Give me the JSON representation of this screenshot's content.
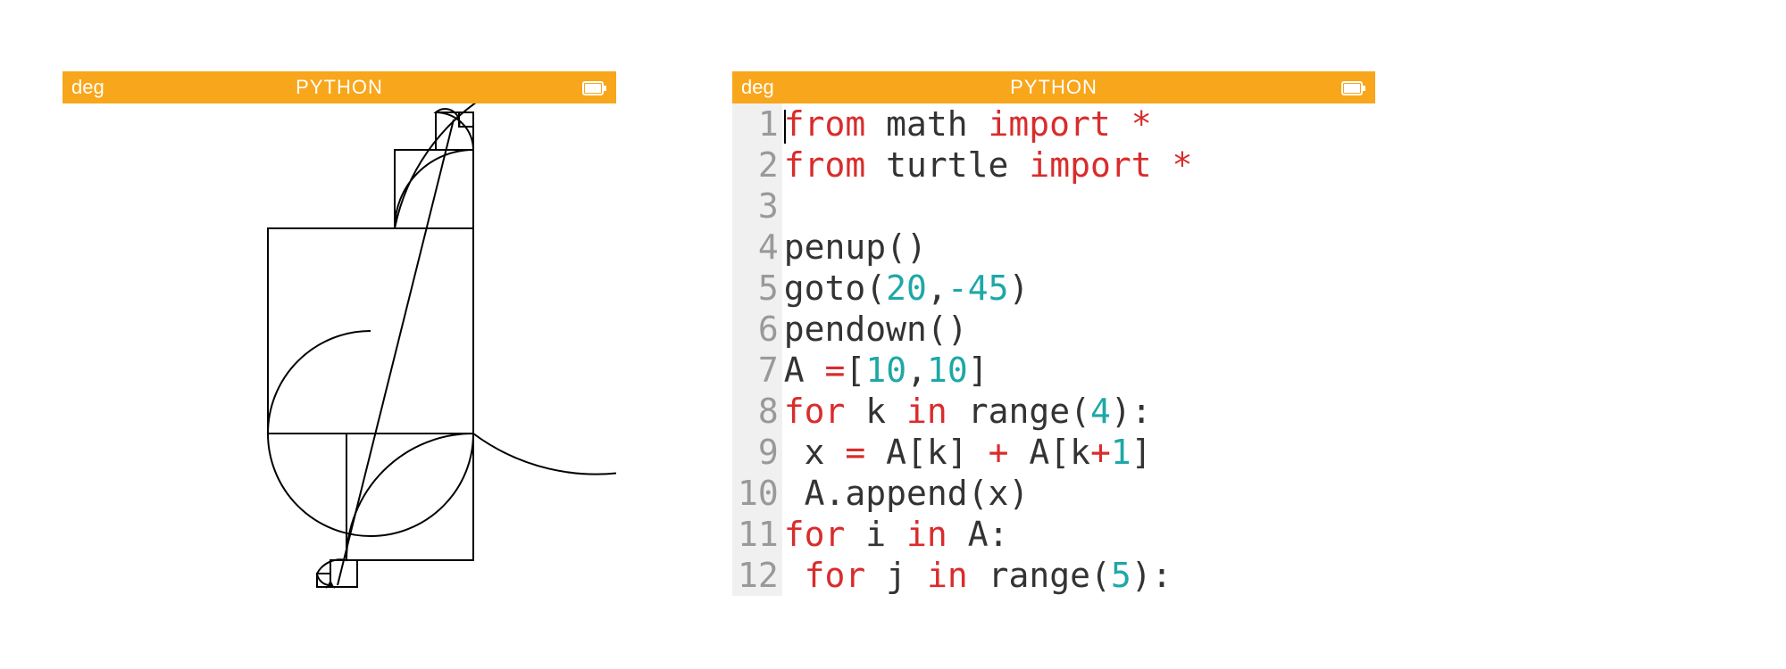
{
  "colors": {
    "titlebar_bg": "#f8a61b",
    "titlebar_fg": "#ffffff",
    "keyword": "#d92c2c",
    "number": "#1fa7a7",
    "text": "#333333",
    "gutter_bg": "#f0f0f0",
    "gutter_fg": "#999999"
  },
  "left": {
    "angle_mode": "deg",
    "title": "PYTHON",
    "battery_icon": "battery-full-icon"
  },
  "right": {
    "angle_mode": "deg",
    "title": "PYTHON",
    "battery_icon": "battery-full-icon",
    "code_lines": [
      {
        "n": 1,
        "tokens": [
          {
            "t": "from ",
            "c": "kw"
          },
          {
            "t": "math ",
            "c": "id"
          },
          {
            "t": "import ",
            "c": "kw"
          },
          {
            "t": "*",
            "c": "kw"
          }
        ]
      },
      {
        "n": 2,
        "tokens": [
          {
            "t": "from ",
            "c": "kw"
          },
          {
            "t": "turtle ",
            "c": "id"
          },
          {
            "t": "import ",
            "c": "kw"
          },
          {
            "t": "*",
            "c": "kw"
          }
        ]
      },
      {
        "n": 3,
        "tokens": [
          {
            "t": "",
            "c": "txt"
          }
        ]
      },
      {
        "n": 4,
        "tokens": [
          {
            "t": "penup()",
            "c": "id"
          }
        ]
      },
      {
        "n": 5,
        "tokens": [
          {
            "t": "goto(",
            "c": "id"
          },
          {
            "t": "20",
            "c": "num"
          },
          {
            "t": ",",
            "c": "id"
          },
          {
            "t": "-45",
            "c": "num"
          },
          {
            "t": ")",
            "c": "id"
          }
        ]
      },
      {
        "n": 6,
        "tokens": [
          {
            "t": "pendown()",
            "c": "id"
          }
        ]
      },
      {
        "n": 7,
        "tokens": [
          {
            "t": "A ",
            "c": "id"
          },
          {
            "t": "=",
            "c": "kw"
          },
          {
            "t": "[",
            "c": "id"
          },
          {
            "t": "10",
            "c": "num"
          },
          {
            "t": ",",
            "c": "id"
          },
          {
            "t": "10",
            "c": "num"
          },
          {
            "t": "]",
            "c": "id"
          }
        ]
      },
      {
        "n": 8,
        "tokens": [
          {
            "t": "for ",
            "c": "kw"
          },
          {
            "t": "k ",
            "c": "id"
          },
          {
            "t": "in ",
            "c": "kw"
          },
          {
            "t": "range(",
            "c": "id"
          },
          {
            "t": "4",
            "c": "num"
          },
          {
            "t": "):",
            "c": "id"
          }
        ]
      },
      {
        "n": 9,
        "tokens": [
          {
            "t": " x ",
            "c": "id"
          },
          {
            "t": "= ",
            "c": "kw"
          },
          {
            "t": "A[k] ",
            "c": "id"
          },
          {
            "t": "+ ",
            "c": "kw"
          },
          {
            "t": "A[k",
            "c": "id"
          },
          {
            "t": "+",
            "c": "kw"
          },
          {
            "t": "1",
            "c": "num"
          },
          {
            "t": "]",
            "c": "id"
          }
        ]
      },
      {
        "n": 10,
        "tokens": [
          {
            "t": " A.append(x)",
            "c": "id"
          }
        ]
      },
      {
        "n": 11,
        "tokens": [
          {
            "t": "for ",
            "c": "kw"
          },
          {
            "t": "i ",
            "c": "id"
          },
          {
            "t": "in ",
            "c": "kw"
          },
          {
            "t": "A:",
            "c": "id"
          }
        ]
      },
      {
        "n": 12,
        "tokens": [
          {
            "t": " ",
            "c": "id"
          },
          {
            "t": "for ",
            "c": "kw"
          },
          {
            "t": "j ",
            "c": "id"
          },
          {
            "t": "in ",
            "c": "kw"
          },
          {
            "t": "range(",
            "c": "id"
          },
          {
            "t": "5",
            "c": "num"
          },
          {
            "t": "):",
            "c": "id"
          }
        ]
      }
    ]
  }
}
